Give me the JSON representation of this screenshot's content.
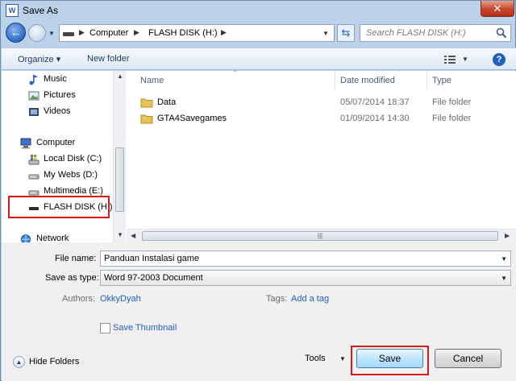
{
  "window": {
    "title": "Save As",
    "close_label": "✕",
    "app_icon_label": "W"
  },
  "address_bar": {
    "crumbs": [
      "Computer",
      "FLASH DISK (H:)"
    ]
  },
  "search": {
    "placeholder": "Search FLASH DISK (H:)"
  },
  "toolbar": {
    "organize": "Organize ▾",
    "new_folder": "New folder",
    "help": "?"
  },
  "nav_pane": {
    "items": [
      {
        "label": "Music",
        "icon": "music-icon"
      },
      {
        "label": "Pictures",
        "icon": "pictures-icon"
      },
      {
        "label": "Videos",
        "icon": "videos-icon"
      },
      {
        "label": "Computer",
        "icon": "computer-icon"
      },
      {
        "label": "Local Disk (C:)",
        "icon": "local-disk-icon"
      },
      {
        "label": "My Webs (D:)",
        "icon": "drive-icon"
      },
      {
        "label": "Multimedia (E:)",
        "icon": "drive-icon"
      },
      {
        "label": "FLASH DISK (H:)",
        "icon": "flash-disk-icon"
      },
      {
        "label": "Network",
        "icon": "network-icon"
      }
    ]
  },
  "file_list": {
    "columns": [
      "Name",
      "Date modified",
      "Type"
    ],
    "rows": [
      {
        "name": "Data",
        "date": "05/07/2014 18:37",
        "type": "File folder"
      },
      {
        "name": "GTA4Savegames",
        "date": "01/09/2014 14:30",
        "type": "File folder"
      }
    ]
  },
  "form": {
    "file_name_label": "File name:",
    "file_name_value": "Panduan Instalasi game",
    "save_type_label": "Save as type:",
    "save_type_value": "Word 97-2003 Document",
    "authors_label": "Authors:",
    "authors_value": "OkkyDyah",
    "tags_label": "Tags:",
    "tags_value": "Add a tag",
    "thumbnail_label": "Save Thumbnail",
    "thumbnail_checked": false,
    "hide_folders": "Hide Folders",
    "tools": "Tools",
    "save": "Save",
    "cancel": "Cancel"
  },
  "colors": {
    "highlight_box": "#d41a1a",
    "link": "#1f5fbf"
  }
}
